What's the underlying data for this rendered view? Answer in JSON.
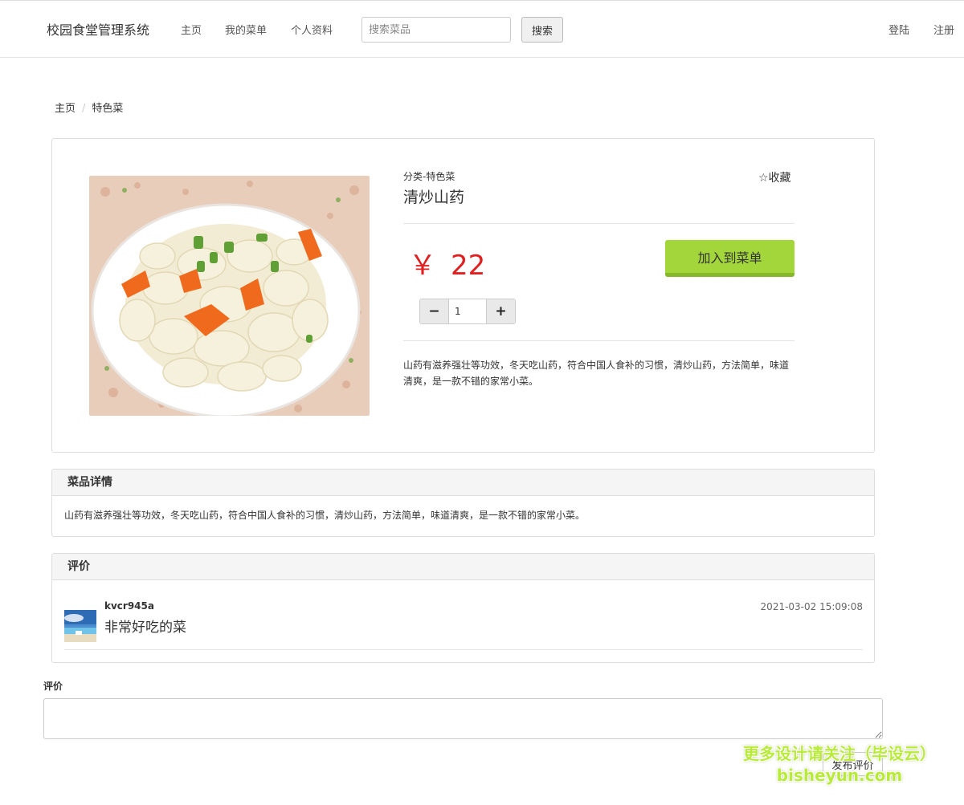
{
  "header": {
    "brand": "校园食堂管理系统",
    "nav": [
      "主页",
      "我的菜单",
      "个人资料"
    ],
    "search_placeholder": "搜索菜品",
    "search_button": "搜索",
    "login": "登陆",
    "register": "注册"
  },
  "breadcrumb": {
    "home": "主页",
    "sep": "/",
    "current": "特色菜"
  },
  "product": {
    "category": "分类-特色菜",
    "name": "清炒山药",
    "favorite": "☆收藏",
    "currency": "￥",
    "price": "22",
    "add_to_menu": "加入到菜单",
    "quantity": "1",
    "minus": "−",
    "plus": "+",
    "description": "山药有滋养强壮等功效，冬天吃山药，符合中国人食补的习惯，清炒山药，方法简单，味道清爽，是一款不错的家常小菜。"
  },
  "details": {
    "heading": "菜品详情",
    "text": "山药有滋养强壮等功效，冬天吃山药，符合中国人食补的习惯，清炒山药，方法简单，味道清爽，是一款不错的家常小菜。"
  },
  "reviews": {
    "heading": "评价",
    "items": [
      {
        "user": "kvcr945a",
        "text": "非常好吃的菜",
        "time": "2021-03-02 15:09:08"
      }
    ]
  },
  "comment_form": {
    "label": "评价",
    "value": "",
    "submit": "发布评价"
  },
  "watermark": {
    "line1": "更多设计请关注（毕设云）",
    "line2": "bisheyun.com"
  },
  "colors": {
    "price": "#e02020",
    "add_button": "#a2d63a",
    "watermark": "#b8ea3a"
  }
}
